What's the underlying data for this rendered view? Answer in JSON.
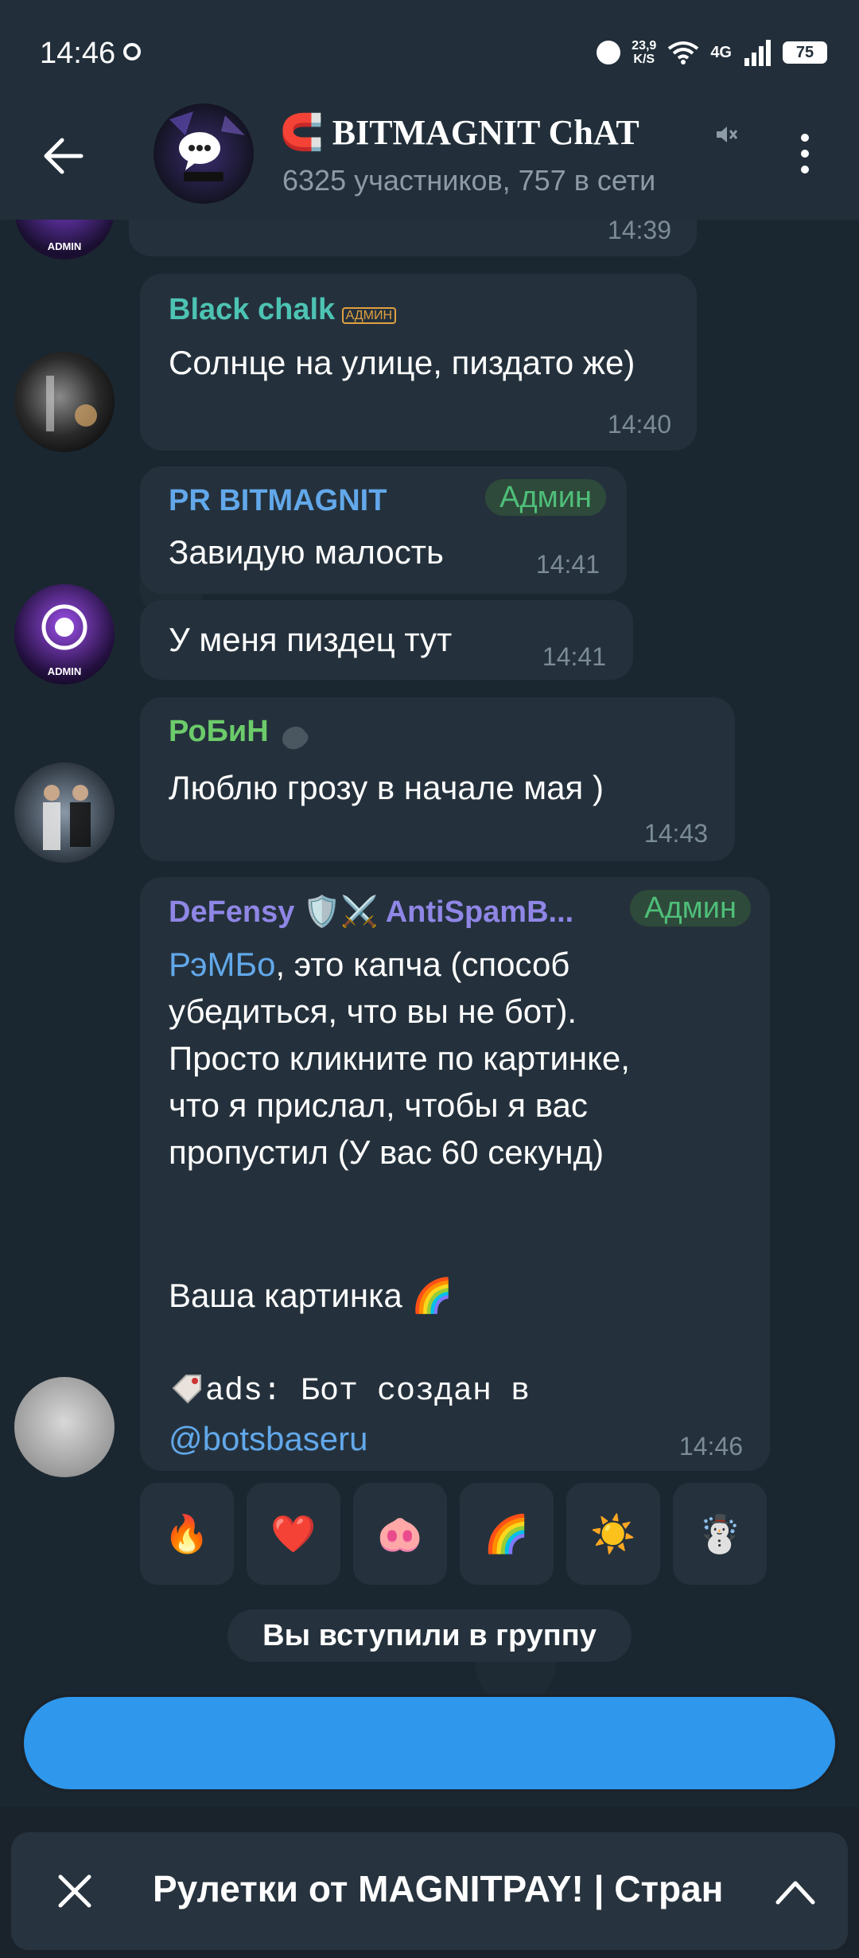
{
  "status_bar": {
    "time": "14:46",
    "speed_value": "23,9",
    "speed_unit": "K/S",
    "network": "4G",
    "battery": "75"
  },
  "header": {
    "title": "BITMAGNIT ChAT",
    "subtitle": "6325 участников, 757 в сети"
  },
  "messages": [
    {
      "time": "14:39"
    },
    {
      "sender": "Black chalk",
      "sender_color": "#4dc3b3",
      "badge": "АДМИН",
      "text": "Солнце на улице, пиздато же)",
      "time": "14:40"
    },
    {
      "sender": "PR BITMAGNIT",
      "sender_color": "#62a8ea",
      "role": "Админ",
      "text": "Завидую малость",
      "time": "14:41"
    },
    {
      "text": "У меня пиздец тут",
      "time": "14:41"
    },
    {
      "sender": "РоБиН",
      "sender_color": "#6ccb6a",
      "text": "Люблю грозу в начале мая )",
      "time": "14:43"
    },
    {
      "sender": "DeFensy 🛡️⚔️ AntiSpamB...",
      "sender_color": "#8f86e6",
      "role": "Админ",
      "mention": "РэМБо",
      "text_after_mention": ", это капча (способ убедиться, что вы не бот). Просто кликните по картинке, что я прислал, чтобы я вас пропустил (У вас 60 секунд)",
      "picture_line": "Ваша картинка 🌈",
      "ads_prefix": "ads: Бот создан в",
      "ads_link": "@botsbaseru",
      "time": "14:46"
    }
  ],
  "reactions": [
    "🔥",
    "❤️",
    "🐽",
    "🌈",
    "☀️",
    "☃️"
  ],
  "service_message": "Вы вступили в группу",
  "pinned": {
    "text": "Рулетки от MAGNITPAY! | Стран"
  }
}
